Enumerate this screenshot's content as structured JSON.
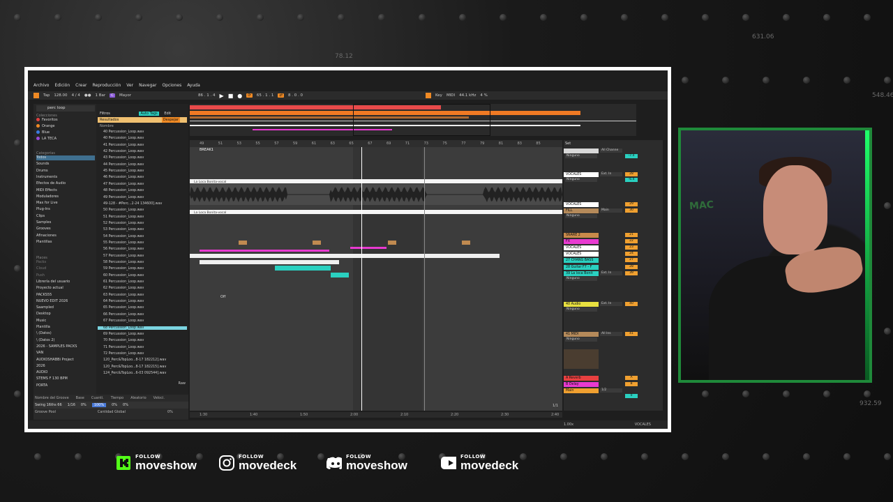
{
  "background": {
    "numbers": [
      "78.12",
      "631.06",
      "548.46",
      "932.59"
    ]
  },
  "daw": {
    "menu": [
      "Archivo",
      "Edición",
      "Crear",
      "Reproducción",
      "Ver",
      "Navegar",
      "Opciones",
      "Ayuda"
    ],
    "transport": {
      "tap": "Tap",
      "tempo": "128.00",
      "signature": "4 / 4",
      "quantize": "1 Bar",
      "key": "C",
      "scale": "Mayor",
      "position": "86 . 1 . 4",
      "arrangement_pos": "65 . 1 . 1",
      "loop_length": "8 . 0 . 0",
      "key_map": "Key",
      "midi": "MIDI",
      "sample_rate": "44.1 kHz",
      "cpu": "4 %"
    },
    "browser": {
      "search": "perc loop",
      "collections_header": "Colecciones",
      "collections": [
        {
          "label": "Favoritos",
          "color": "#e04040"
        },
        {
          "label": "Orange",
          "color": "#f08a24"
        },
        {
          "label": "Blue",
          "color": "#3b7be0"
        },
        {
          "label": "LA TECA",
          "color": "#9a4ad8"
        }
      ],
      "categories_header": "Categorías",
      "categories": [
        "Todos",
        "Sounds",
        "Drums",
        "Instruments",
        "Efectos de Audio",
        "MIDI Effects",
        "Moduladores",
        "Max for Live",
        "Plug-Ins",
        "Clips",
        "Samples",
        "Grooves",
        "Afinaciones",
        "Plantillas"
      ],
      "places_header": "Places",
      "places": [
        "Packs",
        "Cloud",
        "Push",
        "Librería del usuario",
        "Proyecto actual",
        "PACKS55",
        "NUEVO EDIT 2026",
        "Saampled",
        "Desktop",
        "Music",
        "Plantilla",
        "\\ (Datos)",
        "\\ (Datos 2)",
        "2026 - SAMPLES PACKS",
        "VAN",
        "AUDIOSHABBi Project",
        "2026",
        "AUDIO",
        "STEMS F 130 BPM",
        "PORTA"
      ],
      "filters_label": "Filtros",
      "autotags_label": "Auto Tags",
      "edit_label": "Edit",
      "results_label": "Resultados",
      "clear_label": "Despejar",
      "name_header": "Nombre",
      "files": [
        "40 Percussion_Loop.wav",
        "40 Percussion_Loop.wav",
        "41 Percussion_Loop.wav",
        "42 Percussion_Loop.wav",
        "43 Percussion_Loop.wav",
        "44 Percussion_Loop.wav",
        "45 Percussion_Loop.wav",
        "46 Percussion_Loop.wav",
        "47 Percussion_Loop.wav",
        "48 Percussion_Loop.wav",
        "49 Percussion_Loop.wav",
        "49-128 - #Perc...2-24 134600].wav",
        "50 Percussion_Loop.wav",
        "51 Percussion_Loop.wav",
        "52 Percussion_Loop.wav",
        "53 Percussion_Loop.wav",
        "54 Percussion_Loop.wav",
        "55 Percussion_Loop.wav",
        "56 Percussion_Loop.wav",
        "57 Percussion_Loop.wav",
        "58 Percussion_Loop.wav",
        "59 Percussion_Loop.wav",
        "60 Percussion_Loop.wav",
        "61 Percussion_Loop.wav",
        "62 Percussion_Loop.wav",
        "63 Percussion_Loop.wav",
        "64 Percussion_Loop.wav",
        "65 Percussion_Loop.wav",
        "66 Percussion_Loop.wav",
        "67 Percussion_Loop.wav",
        "68 Percussion_Loop.wav",
        "69 Percussion_Loop.wav",
        "70 Percussion_Loop.wav",
        "71 Percussion_Loop.wav",
        "72 Percussion_Loop.wav",
        "120_Perc&TopLoo...8-17 182212].wav",
        "120_Perc&TopLoo...8-17 182215].wav",
        "124_Perc&TopLoo...6-03 092544].wav"
      ],
      "selected_file": "68 Percussion_Loop.wav",
      "raw_label": "Raw"
    },
    "groove": {
      "header_name": "Nombre del Groove",
      "header_base": "Base",
      "header_quant": "Cuanti.",
      "header_timing": "Tiempo",
      "header_random": "Aleatorio",
      "header_velocity": "Veloci.",
      "groove_name": "Swing 16ths 66",
      "base": "1/16",
      "quant": "0%",
      "timing": "100%",
      "random": "0%",
      "velocity": "0%",
      "pool_label": "Groove Pool",
      "global_label": "Cantidad Global",
      "global_value": "0%"
    },
    "arrangement": {
      "ruler": [
        "49",
        "51",
        "53",
        "55",
        "57",
        "59",
        "61",
        "63",
        "65",
        "67",
        "69",
        "71",
        "73",
        "75",
        "77",
        "79",
        "81",
        "83",
        "85"
      ],
      "locator": "BREAK1",
      "vocal_clip_1": "La Loca Bonita-vocal",
      "vocal_clip_2": "La Loca Bonita-vocal",
      "off_label": "Off",
      "time_ruler": [
        "1:30",
        "1:40",
        "1:50",
        "2:00",
        "2:10",
        "2:20",
        "2:30",
        "2:40"
      ]
    },
    "mixer": {
      "set_label": "Set",
      "tracks": [
        {
          "name": "",
          "color": "#d8d8d8",
          "input": "All Channe",
          "route": "Ninguno",
          "vol": "-7.4",
          "n": ""
        },
        {
          "name": "VOCALES",
          "color": "#ffffff",
          "input": "Ext. In",
          "route": "Ninguno",
          "vol": "-6.4",
          "n": "28"
        },
        {
          "name": "VOCALES",
          "color": "#ffffff",
          "input": "",
          "route": "",
          "vol": "",
          "n": "29"
        },
        {
          "name": "FILL",
          "color": "#b58a5a",
          "input": "Main",
          "route": "Ninguno",
          "vol": "",
          "n": "30"
        },
        {
          "name": "SNARE 2",
          "color": "#c98a4a",
          "input": "",
          "route": "",
          "vol": "",
          "n": "21"
        },
        {
          "name": "FX",
          "color": "#e83ad0",
          "input": "",
          "route": "",
          "vol": "",
          "n": "22"
        },
        {
          "name": "VOCALES",
          "color": "#ffffff",
          "input": "",
          "route": "",
          "vol": "",
          "n": "23"
        },
        {
          "name": "VOCALES",
          "color": "#ffffff",
          "input": "",
          "route": "",
          "vol": "",
          "n": "24"
        },
        {
          "name": "27 CHANG BASS",
          "color": "#2ad0c0",
          "input": "",
          "route": "",
          "vol": "",
          "n": "27"
        },
        {
          "name": "28 Guitar F7 - F",
          "color": "#2ad0c0",
          "input": "",
          "route": "",
          "vol": "",
          "n": "28"
        },
        {
          "name": "39 La loca Bonit",
          "color": "#2ad0c0",
          "input": "Ext. In",
          "route": "Ninguno",
          "vol": "",
          "n": "39"
        },
        {
          "name": "40 Audio",
          "color": "#e8e040",
          "input": "Ext. In",
          "route": "Ninguno",
          "vol": "",
          "n": "40"
        },
        {
          "name": "41 MIDI",
          "color": "#b58a5a",
          "input": "All Ins",
          "route": "Ninguno",
          "vol": "",
          "n": "41"
        },
        {
          "name": "A Reverb",
          "color": "#e84040",
          "input": "",
          "route": "",
          "vol": "",
          "n": "A"
        },
        {
          "name": "B Delay",
          "color": "#e83ad0",
          "input": "",
          "route": "",
          "vol": "",
          "n": "B"
        },
        {
          "name": "Main",
          "color": "#f0a030",
          "input": "1/2",
          "route": "",
          "vol": "0",
          "n": ""
        }
      ],
      "route_labels": {
        "in": "In",
        "auto": "Auto",
        "off": "Off",
        "main": "Main"
      },
      "page": "1/1",
      "pos_value": "1.00x",
      "selected_track": "VOCALES"
    }
  },
  "socials": [
    {
      "follow": "FOLLOW",
      "handle": "moveshow",
      "icon": "kick-icon",
      "color": "#53fc18"
    },
    {
      "follow": "FOLLOW",
      "handle": "movedeck",
      "icon": "instagram-icon",
      "color": "#ffffff"
    },
    {
      "follow": "FOLLOW",
      "handle": "moveshow",
      "icon": "discord-icon",
      "color": "#ffffff"
    },
    {
      "follow": "FOLLOW",
      "handle": "movedeck",
      "icon": "youtube-icon",
      "color": "#ffffff"
    }
  ],
  "webcam": {
    "wall_text": "MAC"
  }
}
